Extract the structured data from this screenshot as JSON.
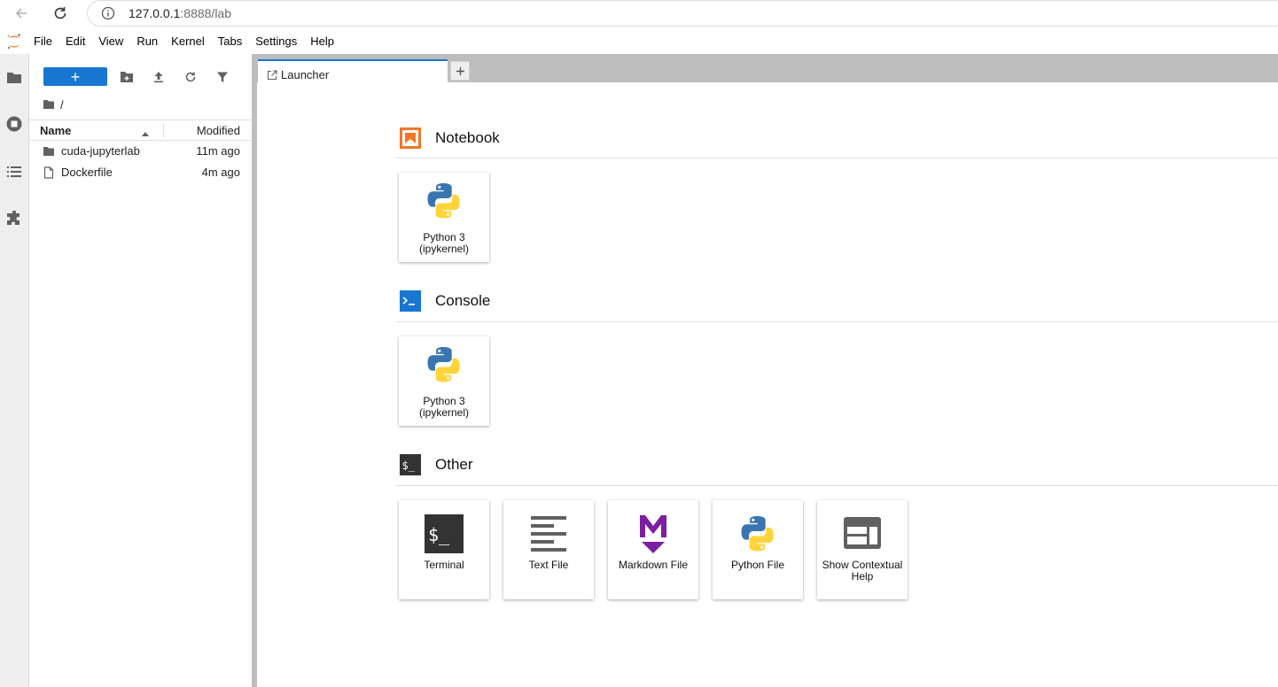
{
  "browser": {
    "url_host": "127.0.0.1",
    "url_rest": ":8888/lab"
  },
  "menu": [
    "File",
    "Edit",
    "View",
    "Run",
    "Kernel",
    "Tabs",
    "Settings",
    "Help"
  ],
  "filebrowser": {
    "new_label": "+",
    "path": "/",
    "col_name": "Name",
    "col_modified": "Modified",
    "files": [
      {
        "name": "cuda-jupyterlab",
        "modified": "11m ago",
        "type": "folder"
      },
      {
        "name": "Dockerfile",
        "modified": "4m ago",
        "type": "file"
      }
    ]
  },
  "tabs": [
    {
      "label": "Launcher"
    }
  ],
  "launcher": {
    "notebook": {
      "title": "Notebook",
      "cards": [
        {
          "label": "Python 3 (ipykernel)"
        }
      ]
    },
    "console": {
      "title": "Console",
      "cards": [
        {
          "label": "Python 3 (ipykernel)"
        }
      ]
    },
    "other": {
      "title": "Other",
      "cards": [
        {
          "label": "Terminal"
        },
        {
          "label": "Text File"
        },
        {
          "label": "Markdown File"
        },
        {
          "label": "Python File"
        },
        {
          "label": "Show Contextual Help"
        }
      ]
    }
  },
  "colors": {
    "accent": "#1976d2",
    "notebook_orange": "#f37726",
    "markdown_purple": "#7b1fa2",
    "python_blue": "#3a75b0",
    "python_yellow": "#ffd43b"
  }
}
